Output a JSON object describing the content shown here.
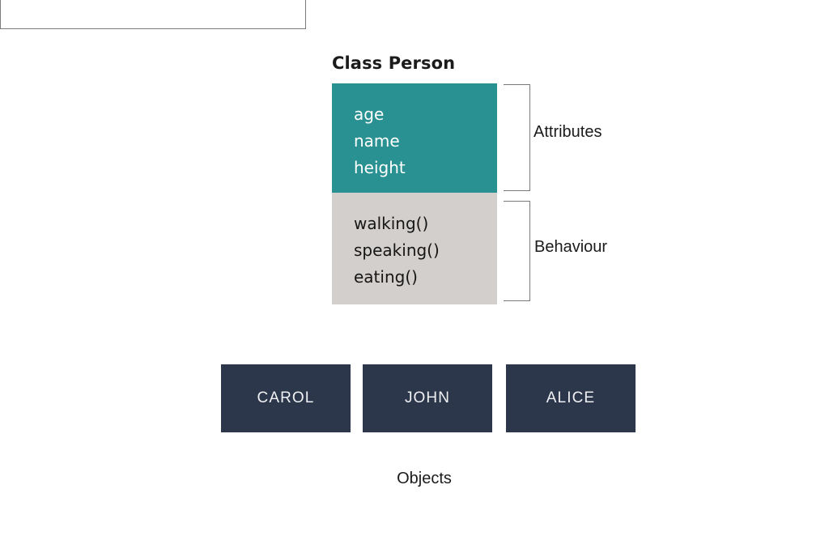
{
  "diagram": {
    "title": "Class Person",
    "class_box": {
      "attributes": {
        "label": "Attributes",
        "members": [
          "age",
          "name",
          "height"
        ],
        "color": "#2a9193",
        "text_color": "#ffffff"
      },
      "behaviour": {
        "label": "Behaviour",
        "members": [
          "walking()",
          "speaking()",
          "eating()"
        ],
        "color": "#d2cfcc",
        "text_color": "#161616"
      }
    },
    "objects": {
      "label": "Objects",
      "items": [
        {
          "name": "CAROL"
        },
        {
          "name": "JOHN"
        },
        {
          "name": "ALICE"
        }
      ],
      "color": "#2c374b",
      "text_color": "#f0f1f3"
    },
    "bracket_color": "#7a7a7a",
    "background": "#ffffff"
  }
}
